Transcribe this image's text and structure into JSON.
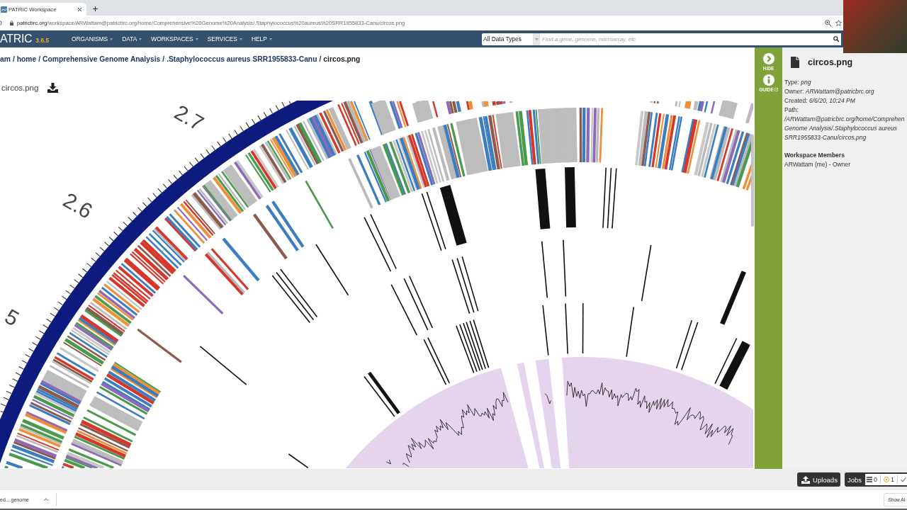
{
  "browser": {
    "tabs": [
      {
        "title": "PATRIC Workspace",
        "selected": true
      }
    ],
    "address": {
      "host": "patricbrc.org",
      "path": "/workspace/ARWattam@patricbrc.org/home/Comprehensive%20Genome%20Analysis/.Staphylococcus%20aureus%20SRR1955833-Canu/circos.png"
    }
  },
  "navbar": {
    "logo": "ATRIC",
    "version": "3.6.5",
    "menu": [
      "ORGANISMS",
      "DATA",
      "WORKSPACES",
      "SERVICES",
      "HELP"
    ],
    "search": {
      "scope": "All Data Types",
      "placeholder": "Find a gene, genome, microarray, etc"
    }
  },
  "breadcrumb": {
    "separator": "/",
    "items": [
      {
        "label": "am",
        "kind": "link"
      },
      {
        "label": "home",
        "kind": "link"
      },
      {
        "label": "Comprehensive Genome Analysis",
        "kind": "link"
      },
      {
        "label": ".Staphylococcus aureus SRR1955833-Canu",
        "kind": "link"
      },
      {
        "label": "circos.png",
        "kind": "current"
      }
    ]
  },
  "viewer": {
    "file_name": "circos.png",
    "plot": {
      "tick_labels": [
        "2.7",
        "2.6",
        "5"
      ]
    }
  },
  "side_rail": {
    "buttons": [
      {
        "label": "HIDE",
        "kind": "hide"
      },
      {
        "label": "GUIDE",
        "kind": "guide"
      }
    ]
  },
  "details": {
    "title": "circos.png",
    "fields": [
      {
        "label": "Type:",
        "value": "png"
      },
      {
        "label": "Owner:",
        "value": "ARWattam@patricbrc.org"
      },
      {
        "label": "Created:",
        "value": "6/6/20, 10:24 PM"
      }
    ],
    "path": {
      "label": "Path:",
      "lines": [
        "/ARWattam@patricbrc.org/home/Comprehen",
        "Genome Analysis/.Staphylococcus aureus",
        "SRR1955833-Canu/circos.png"
      ]
    },
    "members": {
      "heading": "Workspace Members",
      "items": [
        "ARWattam (me) - Owner"
      ]
    }
  },
  "status_bar": {
    "uploads": "Uploads",
    "jobs": {
      "label": "Jobs",
      "queued": "0",
      "running": "1"
    }
  },
  "downloads_bar": {
    "item": "ed....genome",
    "show_all": "Show Al"
  }
}
